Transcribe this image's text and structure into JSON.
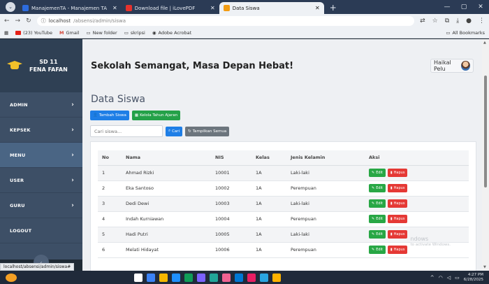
{
  "browser": {
    "tabs": [
      {
        "label": "ManajemenTA - Manajemen TA",
        "fav_color": "#2d6cdf",
        "active": false
      },
      {
        "label": "Download file | iLovePDF",
        "fav_color": "#e5322d",
        "active": false
      },
      {
        "label": "Data Siswa",
        "fav_color": "#f39c12",
        "active": true
      }
    ],
    "new_tab": "+",
    "window_controls": [
      "—",
      "▢",
      "✕"
    ],
    "url_host": "localhost",
    "url_path": "/absensi/admin/siswa",
    "bookmarks": [
      {
        "label": "(23) YouTube",
        "color": "#e62117"
      },
      {
        "label": "Gmail",
        "color": "#d44638"
      },
      {
        "label": "New folder",
        "color": "#f5f5f5"
      },
      {
        "label": "skripsi",
        "color": "#f5f5f5"
      },
      {
        "label": "Adobe Acrobat",
        "color": "#444444"
      }
    ],
    "all_bookmarks": "All Bookmarks",
    "status_url": "localhost/absensi/admin/siswa#"
  },
  "sidebar": {
    "brand_line1": "SD 11",
    "brand_line2": "FENA FAFAN",
    "items": [
      {
        "label": "ADMIN",
        "has_chevron": true
      },
      {
        "label": "KEPSEK",
        "has_chevron": true
      },
      {
        "label": "MENU",
        "has_chevron": true
      },
      {
        "label": "USER",
        "has_chevron": true
      },
      {
        "label": "GURU",
        "has_chevron": true
      },
      {
        "label": "LOGOUT",
        "has_chevron": false
      }
    ],
    "collapse_icon": "‹"
  },
  "header": {
    "tagline": "Sekolah Semangat, Masa Depan Hebat!",
    "user_name": "Haikal Pelu"
  },
  "page": {
    "title": "Data Siswa",
    "buttons": {
      "tambah": "Tambah Siswa",
      "kelola": "Kelola Tahun Ajaran",
      "cari": "Cari",
      "tampilkan": "Tampilkan Semua"
    },
    "search_placeholder": "Cari siswa..."
  },
  "table": {
    "headers": [
      "No",
      "Nama",
      "NIS",
      "Kelas",
      "Jenis Kelamin",
      "Aksi"
    ],
    "rows": [
      [
        "1",
        "Ahmad Rizki",
        "10001",
        "1A",
        "Laki-laki"
      ],
      [
        "2",
        "Eka Santoso",
        "10002",
        "1A",
        "Perempuan"
      ],
      [
        "3",
        "Dedi Dewi",
        "10003",
        "1A",
        "Laki-laki"
      ],
      [
        "4",
        "Indah Kurniawan",
        "10004",
        "1A",
        "Perempuan"
      ],
      [
        "5",
        "Hadi Putri",
        "10005",
        "1A",
        "Laki-laki"
      ],
      [
        "6",
        "Melati Hidayat",
        "10006",
        "1A",
        "Perempuan"
      ]
    ],
    "edit_label": "Edit",
    "hapus_label": "Hapus"
  },
  "watermark": {
    "line1": "ndows",
    "line2": "to activate Windows."
  },
  "taskbar": {
    "time": "4:27 PM",
    "date": "6/28/2025",
    "icon_colors": [
      "#ffffff",
      "#3b82f6",
      "#f5b700",
      "#1e90ff",
      "#0f9d58",
      "#7b61ff",
      "#22a699",
      "#f06292",
      "#0078d4",
      "#e91e63",
      "#2aa5e0",
      "#ffb300"
    ]
  }
}
